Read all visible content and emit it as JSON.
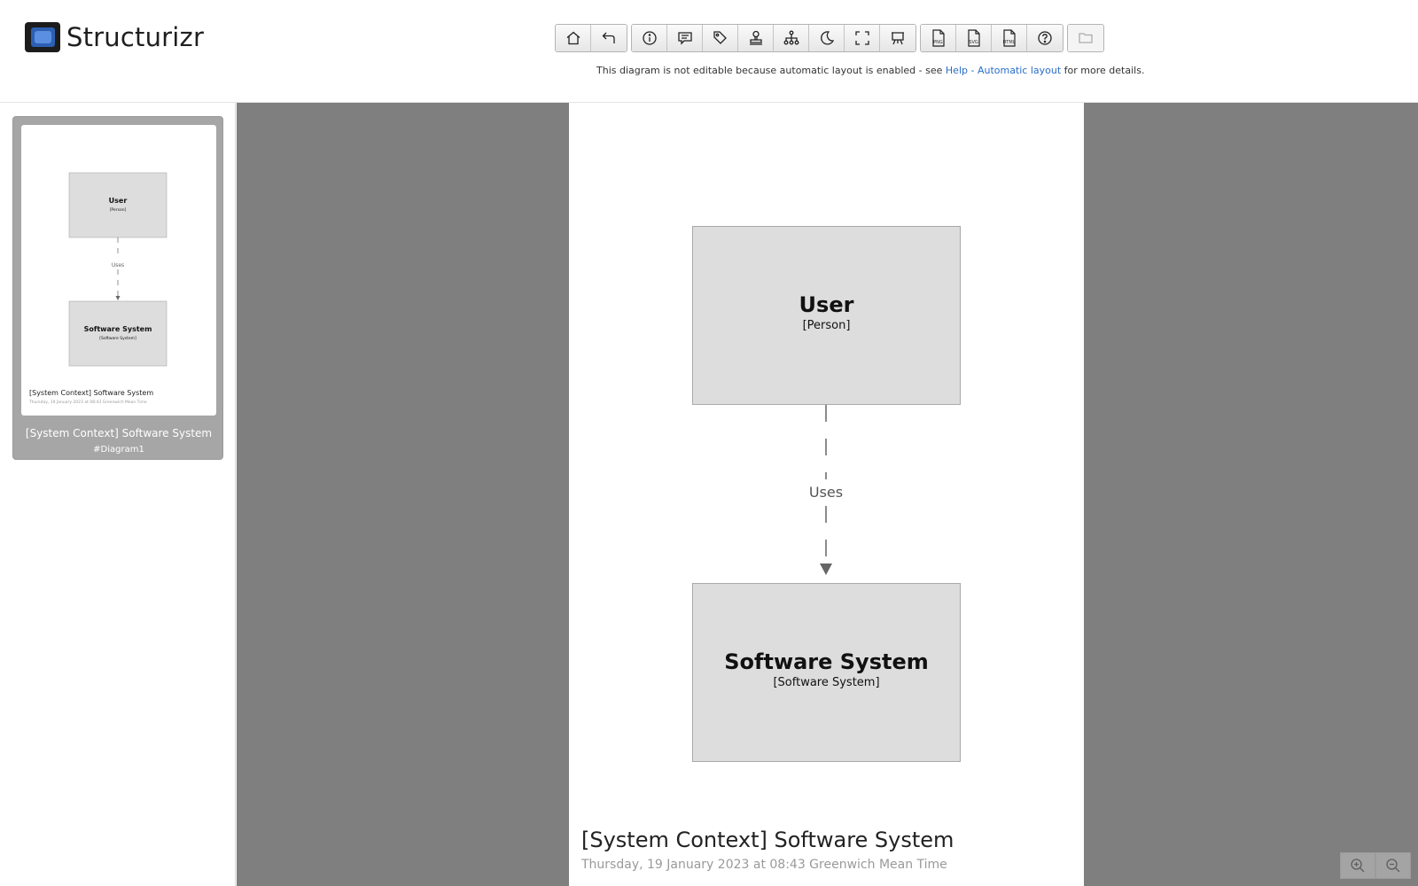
{
  "app": {
    "name": "Structurizr"
  },
  "toolbar": {
    "groups": [
      [
        {
          "name": "home-icon",
          "title": "Home"
        },
        {
          "name": "back-icon",
          "title": "Back"
        }
      ],
      [
        {
          "name": "info-icon"
        },
        {
          "name": "comment-icon"
        },
        {
          "name": "tags-icon"
        },
        {
          "name": "stamp-icon"
        },
        {
          "name": "hierarchy-icon"
        },
        {
          "name": "moon-icon"
        },
        {
          "name": "fullscreen-icon"
        },
        {
          "name": "presentation-icon"
        }
      ],
      [
        {
          "name": "png-export-icon",
          "label": "PNG"
        },
        {
          "name": "svg-export-icon",
          "label": "SVG"
        },
        {
          "name": "html-export-icon",
          "label": "HTML"
        },
        {
          "name": "help-icon"
        }
      ],
      [
        {
          "name": "folder-icon",
          "disabled": true
        }
      ]
    ]
  },
  "notice": {
    "prefix": "This diagram is not editable because automatic layout is enabled - see ",
    "link": "Help - Automatic layout",
    "suffix": " for more details."
  },
  "sidebar": {
    "diagrams": [
      {
        "title": "[System Context] Software System",
        "key": "#Diagram1",
        "thumb_date": "Thursday, 19 January 2023 at 08:43 Greenwich Mean Time"
      }
    ]
  },
  "diagram": {
    "title": "[System Context] Software System",
    "date": "Thursday, 19 January 2023 at 08:43 Greenwich Mean Time",
    "elements": {
      "user": {
        "name": "User",
        "type": "[Person]"
      },
      "system": {
        "name": "Software System",
        "type": "[Software System]"
      }
    },
    "relationships": [
      {
        "from": "User",
        "to": "Software System",
        "description": "Uses"
      }
    ]
  },
  "zoom": {
    "controls": [
      "zoom-in-icon",
      "zoom-out-icon"
    ]
  },
  "colors": {
    "canvas": "#7f7f7f",
    "page": "#ffffff",
    "element_fill": "#dddddd",
    "element_border": "#a9a9a9",
    "link": "#2a6ec8",
    "sidebar_card": "#a6a6a6"
  }
}
